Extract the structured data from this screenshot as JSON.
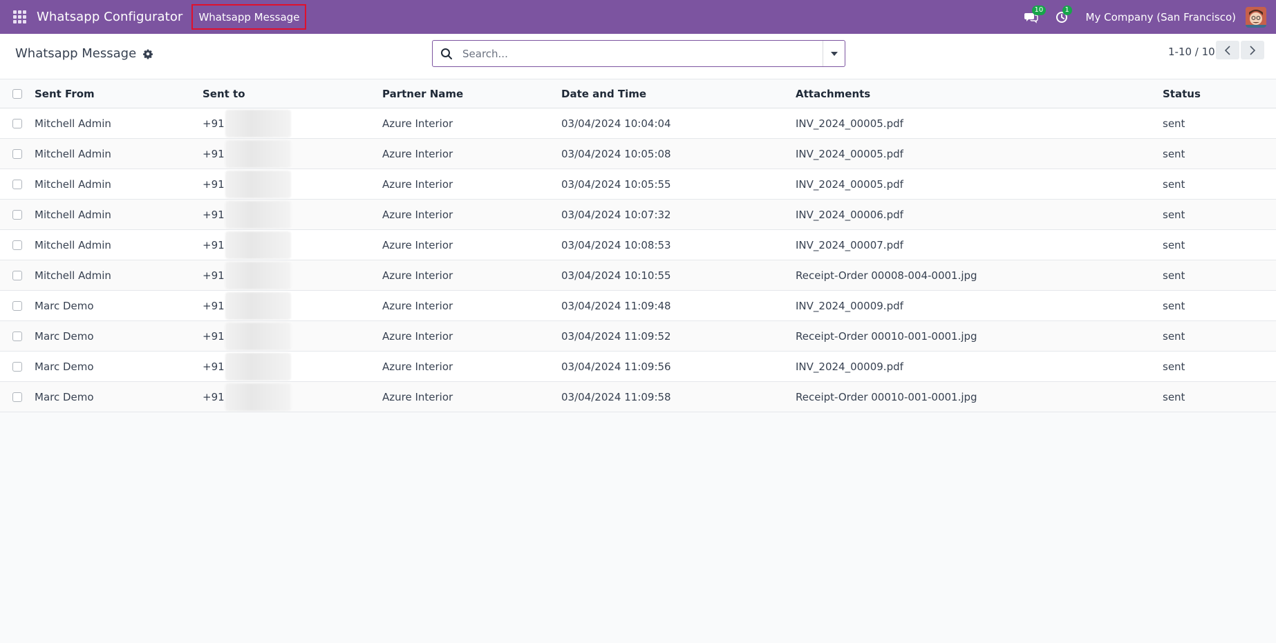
{
  "navbar": {
    "app_title": "Whatsapp Configurator",
    "menu_item": "Whatsapp Message",
    "messages_count": "10",
    "activities_count": "1",
    "company": "My Company (San Francisco)",
    "bg_color": "#7c54a0",
    "highlight_color": "#e0102c"
  },
  "control_panel": {
    "title": "Whatsapp Message",
    "search_placeholder": "Search...",
    "pager": "1-10 / 10"
  },
  "table": {
    "columns": [
      "Sent From",
      "Sent to",
      "Partner Name",
      "Date and Time",
      "Attachments",
      "Status"
    ],
    "rows": [
      {
        "from": "Mitchell Admin",
        "to": "+91",
        "partner": "Azure Interior",
        "date": "03/04/2024 10:04:04",
        "attachment": "INV_2024_00005.pdf",
        "status": "sent"
      },
      {
        "from": "Mitchell Admin",
        "to": "+91",
        "partner": "Azure Interior",
        "date": "03/04/2024 10:05:08",
        "attachment": "INV_2024_00005.pdf",
        "status": "sent"
      },
      {
        "from": "Mitchell Admin",
        "to": "+91",
        "partner": "Azure Interior",
        "date": "03/04/2024 10:05:55",
        "attachment": "INV_2024_00005.pdf",
        "status": "sent"
      },
      {
        "from": "Mitchell Admin",
        "to": "+91",
        "partner": "Azure Interior",
        "date": "03/04/2024 10:07:32",
        "attachment": "INV_2024_00006.pdf",
        "status": "sent"
      },
      {
        "from": "Mitchell Admin",
        "to": "+91",
        "partner": "Azure Interior",
        "date": "03/04/2024 10:08:53",
        "attachment": "INV_2024_00007.pdf",
        "status": "sent"
      },
      {
        "from": "Mitchell Admin",
        "to": "+91",
        "partner": "Azure Interior",
        "date": "03/04/2024 10:10:55",
        "attachment": "Receipt-Order 00008-004-0001.jpg",
        "status": "sent"
      },
      {
        "from": "Marc Demo",
        "to": "+91",
        "partner": "Azure Interior",
        "date": "03/04/2024 11:09:48",
        "attachment": "INV_2024_00009.pdf",
        "status": "sent"
      },
      {
        "from": "Marc Demo",
        "to": "+91",
        "partner": "Azure Interior",
        "date": "03/04/2024 11:09:52",
        "attachment": "Receipt-Order 00010-001-0001.jpg",
        "status": "sent"
      },
      {
        "from": "Marc Demo",
        "to": "+91",
        "partner": "Azure Interior",
        "date": "03/04/2024 11:09:56",
        "attachment": "INV_2024_00009.pdf",
        "status": "sent"
      },
      {
        "from": "Marc Demo",
        "to": "+91",
        "partner": "Azure Interior",
        "date": "03/04/2024 11:09:58",
        "attachment": "Receipt-Order 00010-001-0001.jpg",
        "status": "sent"
      }
    ]
  }
}
